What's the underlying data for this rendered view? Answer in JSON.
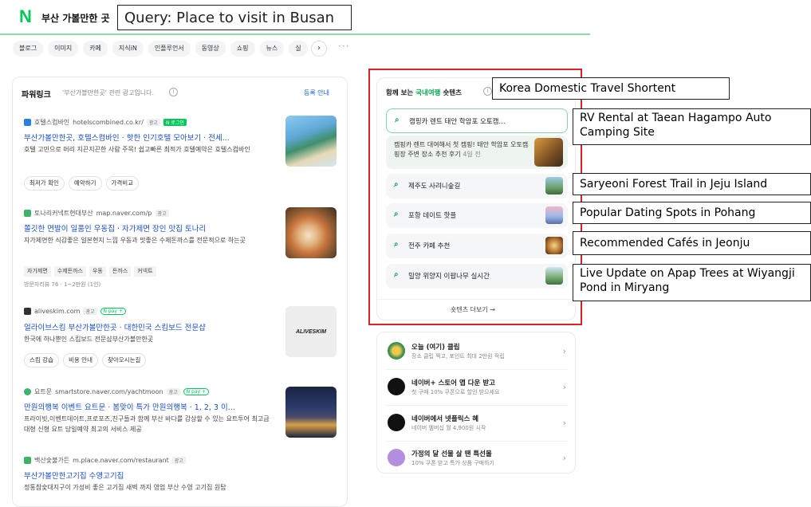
{
  "header": {
    "logo": "N",
    "query_text": "부산 가볼만한 곳",
    "query_annotation": "Query: Place to visit in Busan",
    "tabs": [
      "블로그",
      "이미지",
      "카페",
      "지식iN",
      "인플루언서",
      "동영상",
      "쇼핑",
      "뉴스",
      "실"
    ],
    "more": "···"
  },
  "powerlink": {
    "title": "파워링크",
    "subtitle": "'부산가볼만한곳' 관련 광고입니다.",
    "info_icon": "i",
    "register": "등록 안내",
    "ads": [
      {
        "source": "호텔스컴바인",
        "url": "hotelscombined.co.kr/",
        "badges": [
          "광고",
          "N 로그인"
        ],
        "title": "부산가볼만한곳, 호텔스컴바인 · 핫한 인기호텔 모아보기 · 전세...",
        "desc": "호텔 고민으로 머리 지끈지끈한 사람 주목! 쉽고빠른 최적가 호텔예약은 호텔스컴바인",
        "chips": [
          "최저가 확인",
          "예약하기",
          "가격비교"
        ]
      },
      {
        "source": "토나리커넥트현대부산",
        "url": "map.naver.com/p",
        "badges": [
          "광고"
        ],
        "title": "쫄깃한 면발이 일품인 우동집 · 자가제면 장인 맛집 토나리",
        "desc": "자가제면한 식감좋은 일본현지 느낌 우동과 맛좋은 수제돈까스를 전문적으로 하는곳",
        "tags": [
          "자가제면",
          "수제돈까스",
          "우동",
          "돈까스",
          "커넥트"
        ],
        "meta": "방문자리뷰 76 · 1~2만원 (1인)"
      },
      {
        "source": "aliveskim.com",
        "url": "",
        "badges": [
          "광고",
          "N pay +"
        ],
        "title": "얼라이브스킴 부산가볼만한곳 · 대한민국 스킴보드 전문샵",
        "desc": "한국에 하나뿐인 스킴보드 전문샵부산가볼만한곳",
        "chips": [
          "스킴 강습",
          "비용 안내",
          "찾아오시는길"
        ],
        "thumb_text": "ALIVESKIM"
      },
      {
        "source": "요트문",
        "url": "smartstore.naver.com/yachtmoon",
        "badges": [
          "광고",
          "N pay +"
        ],
        "title": "만원의행복 이벤트 요트문 · 봄맞이 특가 만원의행복 · 1, 2, 3 이...",
        "desc": "프라이빗,이벤트데이트,프로포즈,친구들과 함께 부산 바다를 감상할 수 있는 요트투어 최고급 대형 신형 요트 당일예약 최고의 서비스 제공"
      },
      {
        "source": "백산숯불가든",
        "url": "m.place.naver.com/restaurant",
        "badges": [
          "광고"
        ],
        "title": "부산가볼만한고기집 수영고기집",
        "desc": "정통참숯대지구이 가성비 좋은 고기집 새벽 까지 영업 부산 수영 고기집 원탑"
      }
    ]
  },
  "shortents": {
    "title_prefix": "함께 보는",
    "title_highlight": "국내여행",
    "title_suffix": "숏텐츠",
    "annotation": "Korea Domestic Travel Shortent",
    "items": [
      {
        "label": "캠핑카 렌트 태안 학암포 오토캠...",
        "annotation": "RV Rental at Taean Hagampo Auto Camping Site"
      },
      {
        "label": "제주도 사려니숲길",
        "annotation": "Saryeoni Forest Trail in Jeju Island"
      },
      {
        "label": "포항 데이트 핫플",
        "annotation": "Popular Dating Spots in Pohang"
      },
      {
        "label": "전주 카페 추천",
        "annotation": "Recommended Cafés in Jeonju"
      },
      {
        "label": "밀양 위양지 이팝나무 실시간",
        "annotation": "Live Update on Apap Trees at Wiyangji Pond in Miryang"
      }
    ],
    "expanded_text": "캠핑카 렌트 대여해서 첫 캠핑! 태안 학암포 오토캠핑장 주변 장소 추천 후기",
    "expanded_ago": "4일 전",
    "more": "숏텐츠 더보기 →"
  },
  "promos": [
    {
      "title": "오늘 (여기) 클립",
      "sub": "장소 클립 찍고, 포인트 최대 2만원 적립",
      "icon_color": "#f2c94c"
    },
    {
      "title": "네이버+ 스토어 앱 다운 받고",
      "sub": "첫 구매 10% 쿠폰으로 할인 받으세요",
      "icon_color": "#111111"
    },
    {
      "title": "네이버에서 넷플릭스 혜",
      "sub": "네이버 멤버십 월 4,900원 시작",
      "icon_color": "#111111"
    },
    {
      "title": "가정의 달 선물 살 땐 특선몰",
      "sub": "10% 쿠폰 받고 특가 상품 구매하기",
      "icon_color": "#b48fe0"
    }
  ],
  "colors": {
    "brand_green": "#03c75a",
    "link_blue": "#1a4fc9",
    "highlight_red": "#e02020"
  }
}
